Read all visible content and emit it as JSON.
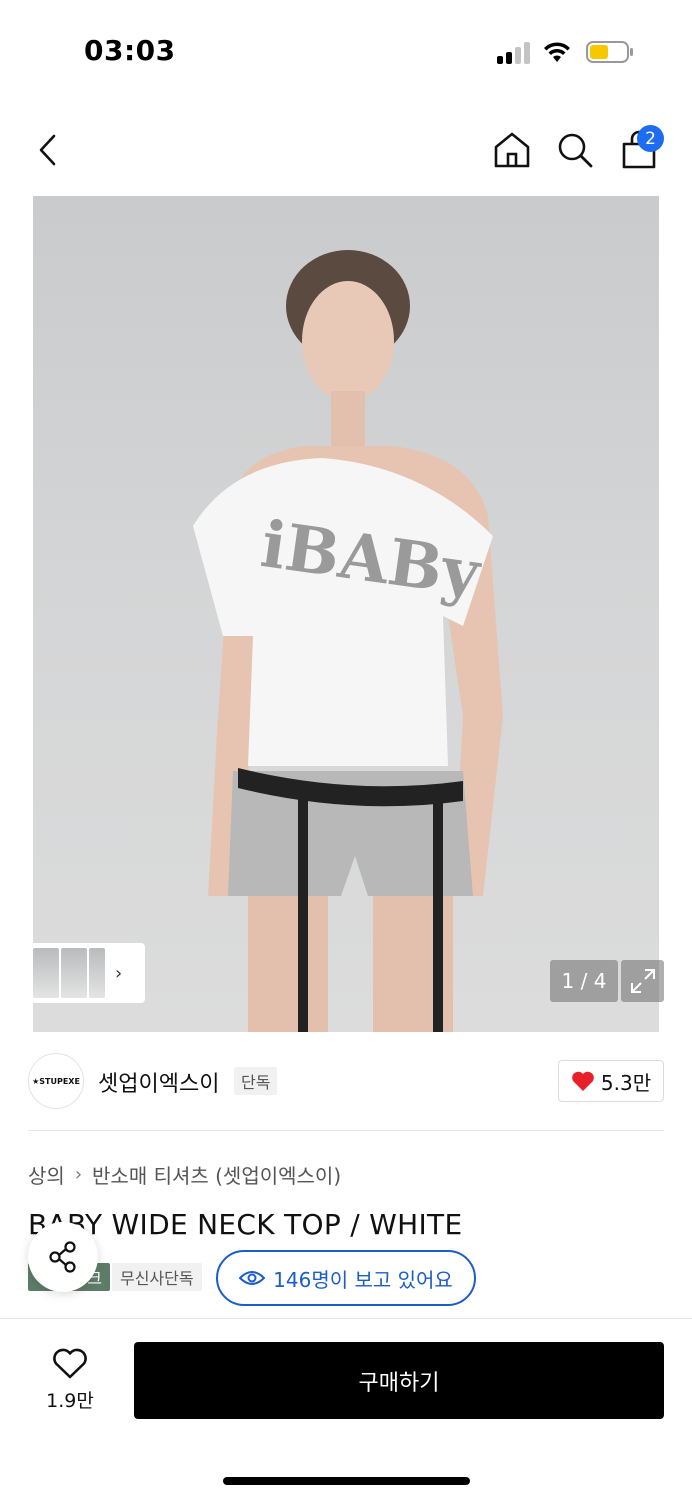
{
  "status": {
    "time": "03:03"
  },
  "cart": {
    "badge": "2"
  },
  "gallery": {
    "counter": "1 / 4"
  },
  "brand": {
    "logo_text": "★STUPEXE",
    "name": "셋업이엑스이",
    "exclusive_tag": "단독",
    "like_count": "5.3만"
  },
  "breadcrumb": {
    "category": "상의",
    "subcategory": "반소매 티셔츠 (셋업이엑스이)"
  },
  "product": {
    "title": "BABY WIDE NECK TOP / WHITE"
  },
  "tags": {
    "green_tag": "크",
    "musinsa_exclusive": "무신사단독",
    "viewers": "146명이 보고 있어요"
  },
  "bottom_bar": {
    "wish_count": "1.9만",
    "buy_label": "구매하기"
  },
  "colors": {
    "accent_blue": "#1e6df0",
    "viewers_blue": "#1c5dc8",
    "heart_red": "#e8202a",
    "tag_green": "#5e7d69",
    "battery_yellow": "#f7c800"
  }
}
